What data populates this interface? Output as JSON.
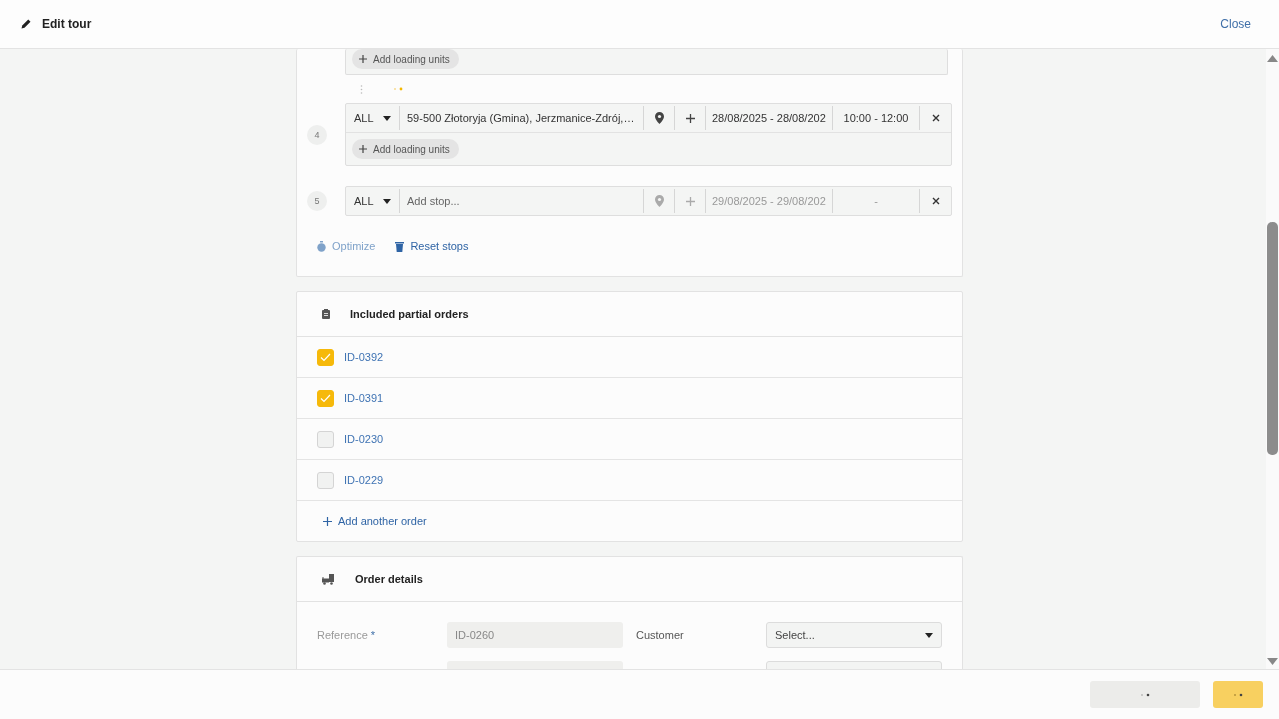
{
  "header": {
    "title": "Edit tour",
    "close": "Close"
  },
  "previous_stop": {
    "loading_button": "Add loading units"
  },
  "stops": [
    {
      "number": "4",
      "type": "ALL",
      "address": "59-500 Złotoryja (Gmina), Jerzmanice-Zdrój,…",
      "dates": "28/08/2025 - 28/08/202",
      "time": "10:00 - 12:00",
      "loading_button": "Add loading units",
      "filled": true
    },
    {
      "number": "5",
      "type": "ALL",
      "placeholder": "Add stop...",
      "dates": "29/08/2025 - 29/08/202",
      "time": "-",
      "filled": false
    }
  ],
  "stop_actions": [
    {
      "label": "Optimize",
      "kind": "optimize",
      "disabled": true
    },
    {
      "label": "Reset stops",
      "kind": "reset",
      "disabled": false
    }
  ],
  "orders": {
    "title": "Included partial orders",
    "items": [
      {
        "id": "ID-0392",
        "checked": true
      },
      {
        "id": "ID-0391",
        "checked": true
      },
      {
        "id": "ID-0230",
        "checked": false
      },
      {
        "id": "ID-0229",
        "checked": false
      }
    ],
    "add_link": "Add another order"
  },
  "order_details": {
    "title": "Order details",
    "reference_label": "Reference",
    "required_mark": "*",
    "reference_value": "ID-0260",
    "customer_label": "Customer",
    "customer_placeholder": "Select..."
  }
}
